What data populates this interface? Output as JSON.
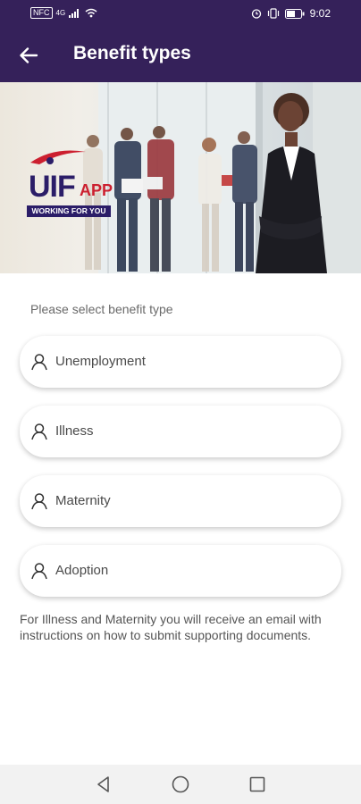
{
  "status_bar": {
    "time": "9:02",
    "left_chips": [
      "NFC"
    ],
    "network": "4G"
  },
  "app_bar": {
    "title": "Benefit types"
  },
  "hero": {
    "logo_text": "UIF",
    "logo_app": "APP",
    "logo_tagline": "WORKING FOR YOU"
  },
  "content": {
    "prompt": "Please select benefit type",
    "options": [
      {
        "label": "Unemployment"
      },
      {
        "label": "Illness"
      },
      {
        "label": "Maternity"
      },
      {
        "label": "Adoption"
      }
    ],
    "note": "For Illness and Maternity you will receive an email with instructions on how to submit supporting documents."
  },
  "colors": {
    "app_bar": "#35215a",
    "logo_navy": "#2b1d68",
    "logo_red": "#cc1f2f"
  },
  "icons": {
    "back": "arrow-left-icon",
    "option": "person-icon",
    "nav": [
      "back-triangle-icon",
      "home-circle-icon",
      "recents-square-icon"
    ]
  }
}
